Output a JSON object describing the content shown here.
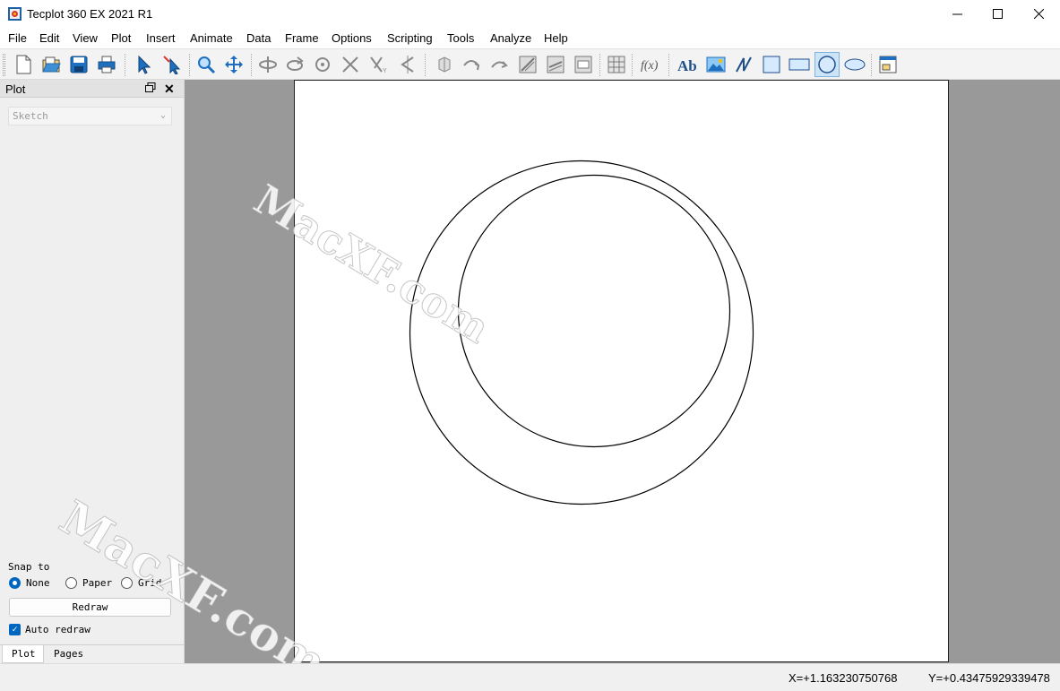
{
  "window": {
    "title": "Tecplot 360 EX 2021 R1"
  },
  "menu": [
    "File",
    "Edit",
    "View",
    "Plot",
    "Insert",
    "Animate",
    "Data",
    "Frame",
    "Options",
    "Scripting",
    "Tools",
    "Analyze",
    "Help"
  ],
  "toolbar": {
    "icons": [
      "new-layout-icon",
      "open-layout-icon",
      "save-icon",
      "print-icon",
      "selector-icon",
      "adjustor-icon",
      "zoom-icon",
      "translate-icon",
      "rotate-x-icon",
      "rotate-y-icon",
      "rotate-z-icon",
      "rotate-xy-icon",
      "rotate-xz-icon",
      "reflect-icon",
      "slice-icon",
      "probe-icon",
      "extract-icon",
      "contour-icon",
      "streamtrace-icon",
      "isosurface-icon",
      "grid-icon",
      "function-icon",
      "text-icon",
      "image-icon",
      "polyline-icon",
      "square-icon",
      "rectangle-icon",
      "circle-icon",
      "ellipse-icon",
      "frame-icon"
    ],
    "active_tool": "circle-icon"
  },
  "panel": {
    "title": "Plot",
    "mode_value": "Sketch",
    "snap_label": "Snap to",
    "snap_options": [
      "None",
      "Paper",
      "Grid"
    ],
    "snap_selected": "None",
    "redraw_label": "Redraw",
    "auto_redraw_label": "Auto redraw",
    "auto_redraw_checked": true,
    "tabs": [
      "Plot",
      "Pages"
    ]
  },
  "workspace": {
    "watermark": "MacXF.com"
  },
  "status": {
    "x": "X=+1.163230750768",
    "y": "Y=+0.43475929339478"
  },
  "colors": {
    "workspace_bg": "#999999",
    "accent": "#0067c0",
    "active_tool_bg": "#cce4f7"
  }
}
